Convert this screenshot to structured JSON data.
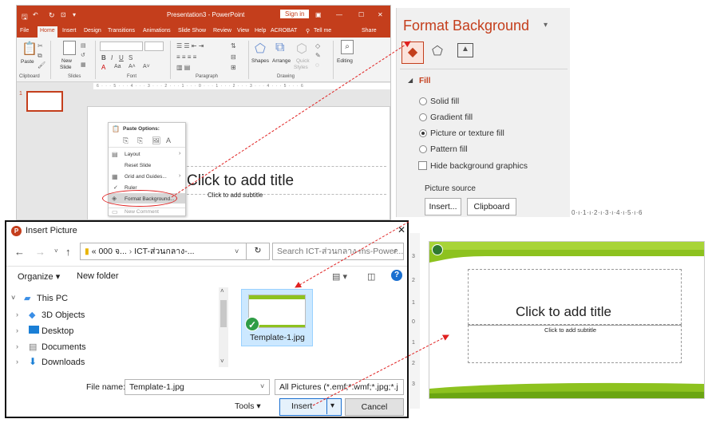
{
  "ppt": {
    "title": "Presentation3 - PowerPoint",
    "sign_in": "Sign in",
    "tabs": [
      "File",
      "Home",
      "Insert",
      "Design",
      "Transitions",
      "Animations",
      "Slide Show",
      "Review",
      "View",
      "Help",
      "ACROBAT",
      "Tell me",
      "Share"
    ],
    "active_tab": "Home",
    "ribbon": {
      "paste": "Paste",
      "new_slide": "New",
      "new_slide_2": "Slide",
      "shapes": "Shapes",
      "arrange": "Arrange",
      "quick_styles": "Quick",
      "quick_styles_2": "Styles",
      "editing": "Editing",
      "groups": [
        "Clipboard",
        "Slides",
        "Font",
        "Paragraph",
        "Drawing"
      ]
    },
    "slide_number": "1",
    "ruler": "6 · · · 5 · · · 4 · · · 3 · · · 2 · · · 1 · · · 0 · · · 1 · · · 2 · · · 3 · · · 4 · · · 5 · · · 6",
    "context_menu": {
      "header": "Paste Options:",
      "items": [
        "Layout",
        "Reset Slide",
        "Grid and Guides...",
        "Ruler",
        "Format Background...",
        "New Comment"
      ]
    },
    "slide_title": "Click to add title",
    "slide_subtitle": "Click to add subtitle"
  },
  "format_background": {
    "title": "Format Background",
    "section": "Fill",
    "options": [
      "Solid fill",
      "Gradient fill",
      "Picture or texture fill",
      "Pattern fill"
    ],
    "selected": "Picture or texture fill",
    "hide_background": "Hide background graphics",
    "picture_source": "Picture source",
    "insert_btn": "Insert...",
    "clipboard_btn": "Clipboard"
  },
  "preview": {
    "ruler_top": "0·ı·1·ı·2·ı·3·ı·4·ı·5·ı·6",
    "title": "Click to add title",
    "subtitle": "Click to add subtitle",
    "accent": "#8dc21f"
  },
  "dialog": {
    "title": "Insert Picture",
    "breadcrumb_1": "« 000 จ...",
    "breadcrumb_2": "ICT-ส่วนกลาง-...",
    "search_placeholder": "Search ICT-ส่วนกลาง-ms-Power...",
    "organize": "Organize",
    "new_folder": "New folder",
    "tree": [
      "This PC",
      "3D Objects",
      "Desktop",
      "Documents",
      "Downloads"
    ],
    "file_name_label": "File name:",
    "file_name": "Template-1.jpg",
    "file_type": "All Pictures (*.emf;*.wmf;*.jpg;*.j",
    "tools": "Tools",
    "insert": "Insert",
    "cancel": "Cancel",
    "file_item": "Template-1.jpg"
  }
}
